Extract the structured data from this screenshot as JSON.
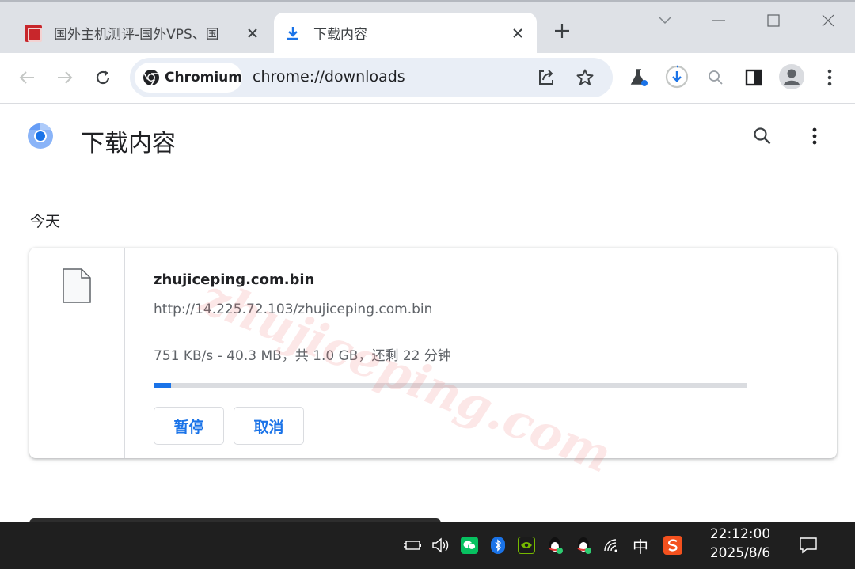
{
  "tabs": [
    {
      "title": "国外主机测评-国外VPS、国",
      "active": false
    },
    {
      "title": "下载内容",
      "active": true
    }
  ],
  "toolbar": {
    "site_chip": "Chromium",
    "url": "chrome://downloads"
  },
  "page": {
    "title": "下载内容"
  },
  "downloads": {
    "date_group": "今天",
    "item": {
      "filename": "zhujiceping.com.bin",
      "source_url": "http://14.225.72.103/zhujiceping.com.bin",
      "status": "751 KB/s - 40.3 MB，共 1.0 GB，还剩 22 分钟",
      "progress_percent": 3,
      "pause_label": "暂停",
      "cancel_label": "取消"
    }
  },
  "watermark": "zhujiceping.com",
  "taskbar": {
    "ime": "中",
    "time": "22:12:00",
    "date": "2025/8/6"
  },
  "colors": {
    "accent": "#1a73e8",
    "tabstrip": "#dee1e6",
    "omnibox": "#e9eef6",
    "taskbar": "#1f1f1f"
  }
}
